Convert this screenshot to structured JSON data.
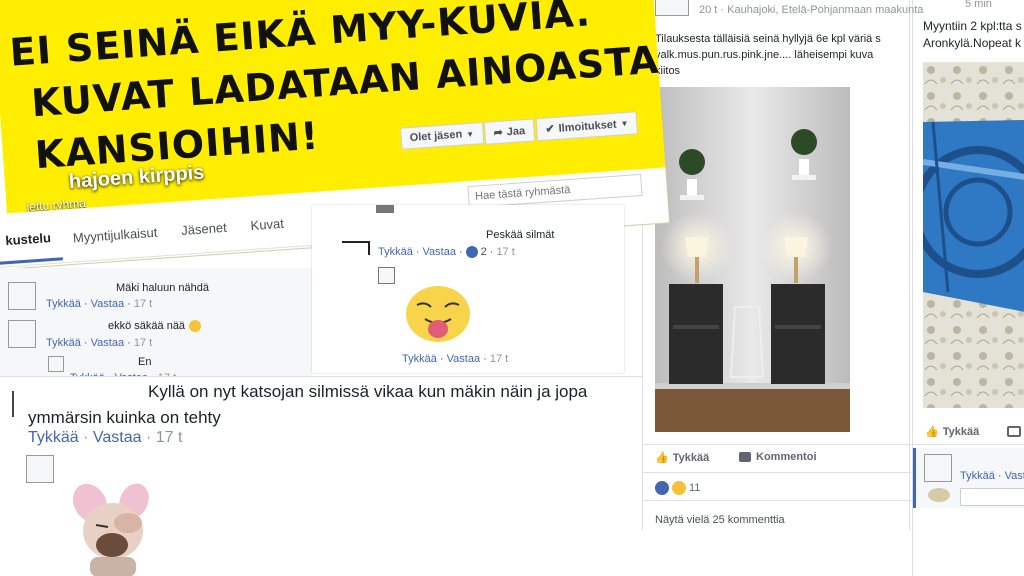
{
  "cover": {
    "banner_lines": [
      "EI SEINÄ EIKÄ MYY-KUVIA.",
      "KUVAT LADATAAN AINOASTAA",
      "KANSIOIHIN!"
    ],
    "group_name": "hajoen kirppis",
    "group_type": "jettu ryhma",
    "member_button": "Olet jäsen",
    "share_button": "Jaa",
    "notify_button": "Ilmoitukset",
    "search_placeholder": "Hae tästä ryhmästä",
    "tabs": [
      "kustelu",
      "Myyntijulkaisut",
      "Jäsenet",
      "Kuvat"
    ]
  },
  "left_comments": [
    {
      "text": "Mäki haluun nähdä",
      "like": "Tykkää",
      "reply": "Vastaa",
      "time": "17 t"
    },
    {
      "text": "ekkö säkää nää",
      "like": "Tykkää",
      "reply": "Vastaa",
      "time": "17 t"
    },
    {
      "text": "En",
      "like": "Tykkää",
      "reply": "Vastaa",
      "time": "17 t"
    }
  ],
  "mid_card": {
    "comment_text": "Peskää silmät",
    "like": "Tykkää",
    "reply": "Vastaa",
    "reaction_count": "2",
    "time": "17 t",
    "sticker_like": "Tykkää",
    "sticker_reply": "Vastaa",
    "sticker_time": "17 t"
  },
  "big_comment": {
    "author_line": "Kyllä on nyt katsojan silmissä vikaa kun mäkin näin ja jopa",
    "line2": "ymmärsin kuinka on tehty",
    "like": "Tykkää",
    "reply": "Vastaa",
    "time": "17 t"
  },
  "post": {
    "meta": "20 t · Kauhajoki, Etelä-Pohjanmaan maakunta",
    "text_lines": [
      "Tilauksesta tälläisiä seinä hyllyjä 6e kpl väriä s",
      "valk.mus.pun.rus.pink.jne.... läheisempi kuva",
      "kiitos"
    ],
    "like_button": "Tykkää",
    "comment_button": "Kommentoi",
    "reaction_count": "11",
    "more_comments": "Näytä vielä 25 kommenttia"
  },
  "right_post": {
    "time": "5 min",
    "text_lines": [
      "Myyntiin 2 kpl:tta s",
      "Aronkylä.Nopeat k"
    ],
    "like_button": "Tykkää",
    "comment_like": "Tykkää",
    "comment_reply": "Vasta"
  },
  "colors": {
    "banner_yellow": "#ffee00",
    "fb_blue": "#4267b2",
    "meta_gray": "#90949c"
  }
}
